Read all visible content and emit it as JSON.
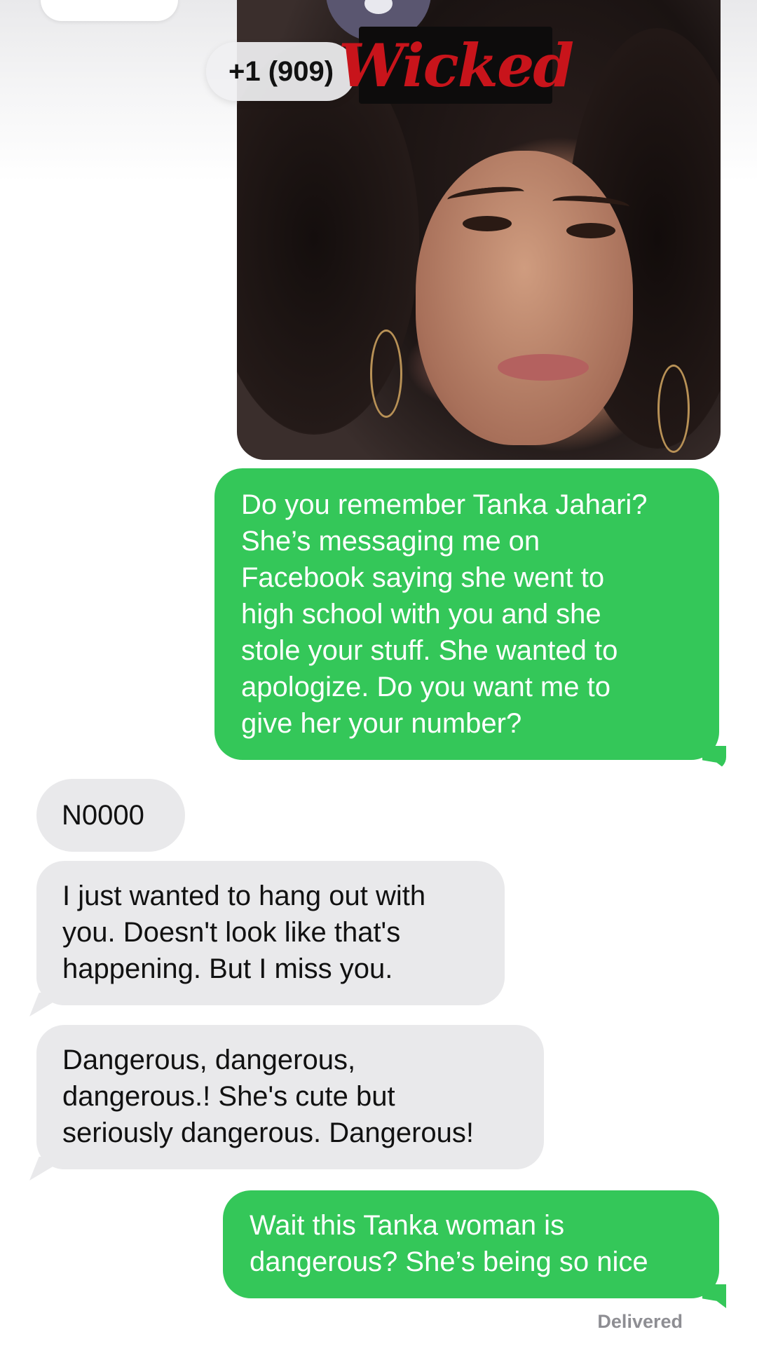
{
  "header": {
    "phone_number": "+1 (909)",
    "sticker_text": "Wicked"
  },
  "messages": [
    {
      "direction": "outgoing",
      "text": "Do you remember Tanka Jahari?\nShe’s messaging me on\nFacebook saying she went to\nhigh school with you and she\nstole your stuff. She wanted to\napologize. Do you want me to\ngive her your number?"
    },
    {
      "direction": "incoming",
      "text": "N0000"
    },
    {
      "direction": "incoming",
      "text": "I just wanted to hang out with\nyou. Doesn't look like that's\nhappening. But I miss you."
    },
    {
      "direction": "incoming",
      "text": "Dangerous, dangerous,\ndangerous.! She's cute but\nseriously dangerous. Dangerous!"
    },
    {
      "direction": "outgoing",
      "text": "Wait this Tanka woman is\ndangerous? She’s being so nice"
    }
  ],
  "status": {
    "delivered": "Delivered"
  },
  "colors": {
    "outgoing_bubble": "#34c759",
    "incoming_bubble": "#e9e9eb",
    "sticker_text": "#c8141b"
  }
}
